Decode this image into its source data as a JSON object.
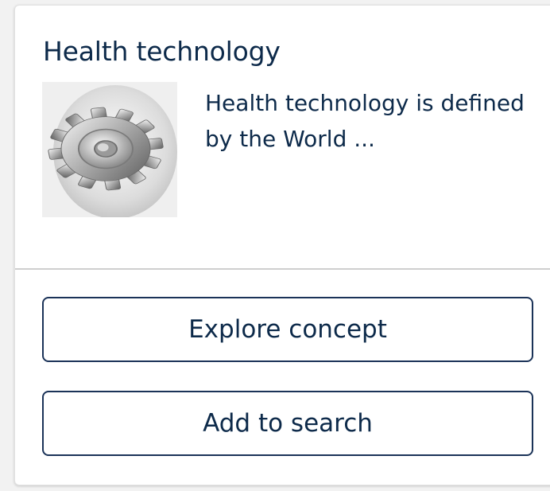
{
  "card": {
    "title": "Health technology",
    "description": "Health technology is defined by the World ...",
    "image_icon": "gear-icon"
  },
  "actions": {
    "explore_label": "Explore concept",
    "add_label": "Add to search"
  },
  "colors": {
    "text": "#0d2a4a",
    "button_border": "#1b3358",
    "divider": "#cfcfcf",
    "page_bg": "#f2f2f2"
  }
}
